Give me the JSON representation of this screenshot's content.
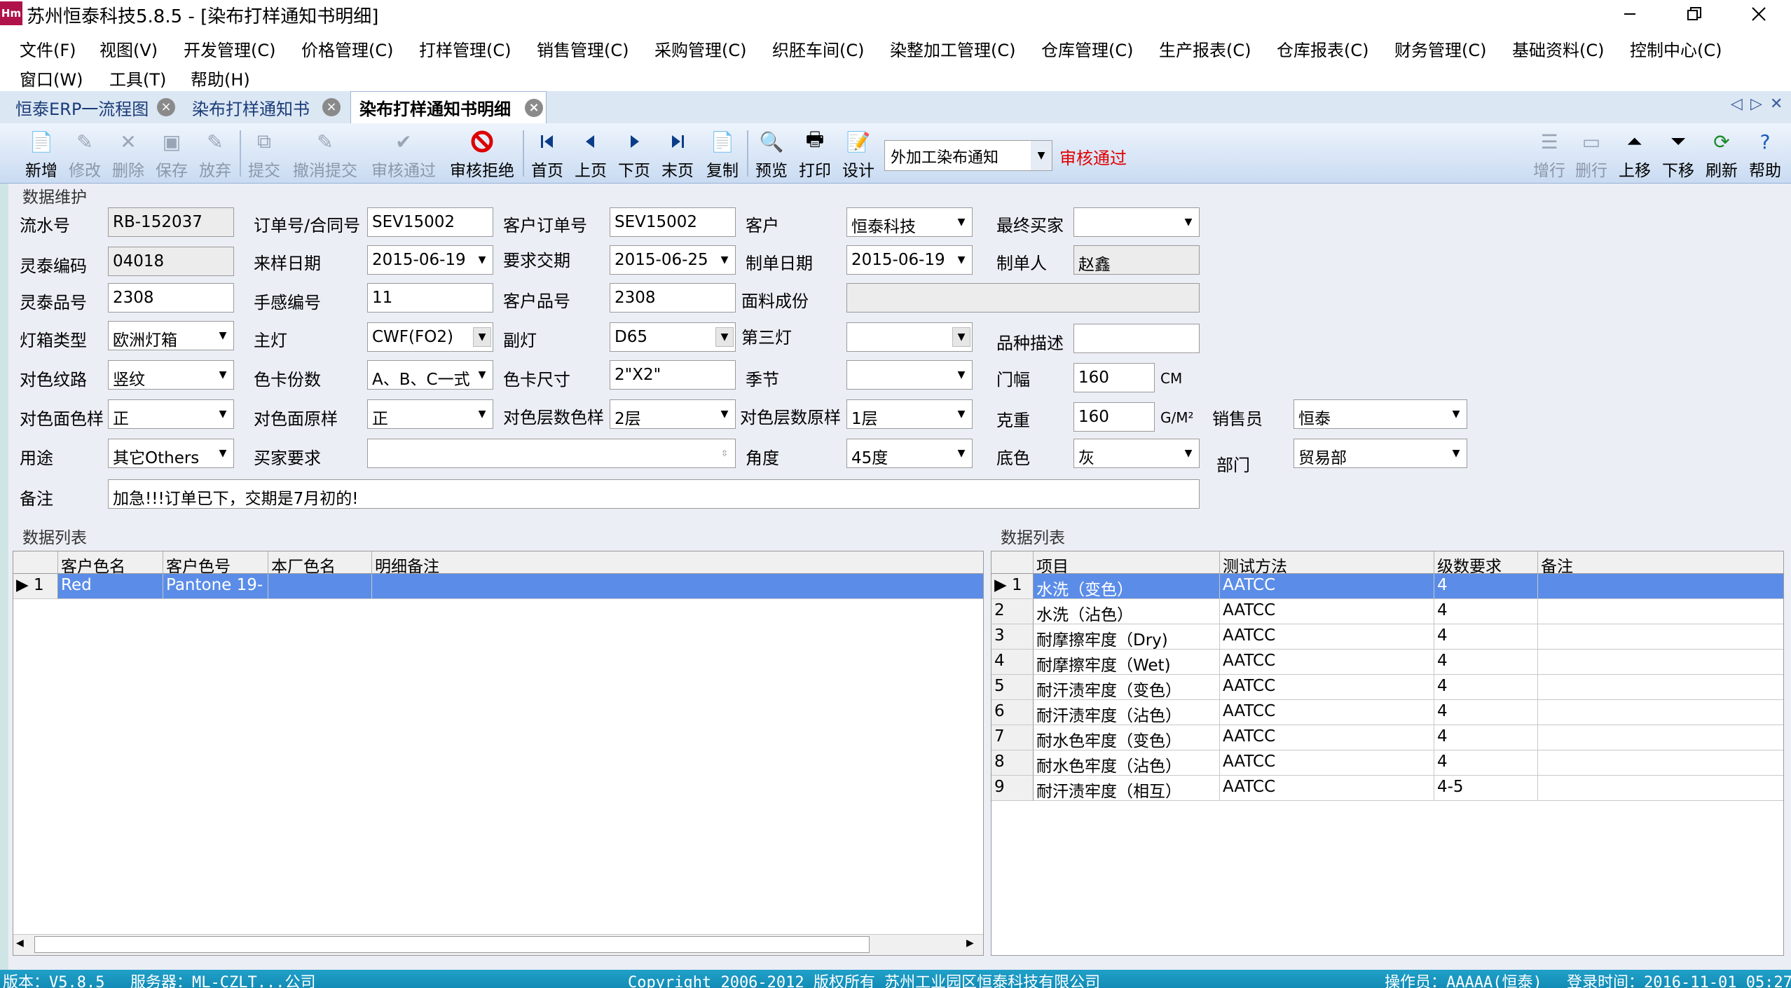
{
  "window": {
    "title": "苏州恒泰科技5.8.5 - [染布打样通知书明细]",
    "icon": "Hm"
  },
  "menu": [
    "文件(F)",
    "视图(V)",
    "开发管理(C)",
    "价格管理(C)",
    "打样管理(C)",
    "销售管理(C)",
    "采购管理(C)",
    "织胚车间(C)",
    "染整加工管理(C)",
    "仓库管理(C)",
    "生产报表(C)",
    "仓库报表(C)",
    "财务管理(C)",
    "基础资料(C)",
    "控制中心(C)",
    "窗口(W)",
    "工具(T)",
    "帮助(H)"
  ],
  "tabs": [
    "恒泰ERP一流程图",
    "染布打样通知书",
    "染布打样通知书明细"
  ],
  "toolbar": {
    "buttons": [
      "新增",
      "修改",
      "删除",
      "保存",
      "放弃",
      "提交",
      "撤消提交",
      "审核通过",
      "审核拒绝",
      "首页",
      "上页",
      "下页",
      "末页",
      "复制",
      "预览",
      "打印",
      "设计"
    ],
    "right_buttons": [
      "增行",
      "删行",
      "上移",
      "下移",
      "刷新",
      "帮助"
    ],
    "doc_type": "外加工染布通知",
    "status": "审核通过"
  },
  "form": {
    "section_title": "数据维护",
    "labels": {
      "serial": "流水号",
      "order": "订单号/合同号",
      "cust_order": "客户订单号",
      "customer": "客户",
      "final_buyer": "最终买家",
      "code": "灵泰编码",
      "sample_date": "来样日期",
      "req_date": "要求交期",
      "make_date": "制单日期",
      "maker": "制单人",
      "product_no": "灵泰品号",
      "hand_no": "手感编号",
      "cust_product": "客户品号",
      "composition": "面料成份",
      "lightbox": "灯箱类型",
      "main_light": "主灯",
      "sub_light": "副灯",
      "third_light": "第三灯",
      "desc": "品种描述",
      "texture": "对色纹路",
      "card_copies": "色卡份数",
      "card_size": "色卡尺寸",
      "season": "季节",
      "width": "门幅",
      "face_sample": "对色面色样",
      "face_orig": "对色面原样",
      "layer_sample": "对色层数色样",
      "layer_orig": "对色层数原样",
      "weight": "克重",
      "sales": "销售员",
      "usage": "用途",
      "buyer_req": "买家要求",
      "angle": "角度",
      "base_color": "底色",
      "dept": "部门",
      "remark": "备注"
    },
    "values": {
      "serial": "RB-152037",
      "order": "SEV15002",
      "cust_order": "SEV15002",
      "customer": "恒泰科技",
      "final_buyer": "",
      "code": "04018",
      "sample_date": "2015-06-19",
      "req_date": "2015-06-25",
      "make_date": "2015-06-19",
      "maker": "赵鑫",
      "product_no": "2308",
      "hand_no": "11",
      "cust_product": "2308",
      "composition": "",
      "lightbox": "欧洲灯箱",
      "main_light": "CWF(FO2)",
      "sub_light": "D65",
      "third_light": "",
      "desc": "",
      "texture": "竖纹",
      "card_copies": "A、B、C一式",
      "card_size": "2\"X2\"",
      "season": "",
      "width": "160",
      "face_sample": "正",
      "face_orig": "正",
      "layer_sample": "2层",
      "layer_orig": "1层",
      "weight": "160",
      "sales": "恒泰",
      "usage": "其它Others",
      "buyer_req": "",
      "angle": "45度",
      "base_color": "灰",
      "dept": "贸易部",
      "remark": "加急!!!订单已下，交期是7月初的!"
    },
    "units": {
      "width": "CM",
      "weight": "G/M²"
    }
  },
  "left_grid": {
    "title": "数据列表",
    "columns": [
      "客户色名",
      "客户色号",
      "本厂色名",
      "明细备注"
    ],
    "rows": [
      {
        "no": "1",
        "c": [
          "Red",
          "Pantone 19-",
          "",
          ""
        ]
      }
    ]
  },
  "right_grid": {
    "title": "数据列表",
    "columns": [
      "项目",
      "测试方法",
      "级数要求",
      "备注"
    ],
    "rows": [
      {
        "no": "1",
        "c": [
          "水洗（变色）",
          "AATCC",
          "4",
          ""
        ]
      },
      {
        "no": "2",
        "c": [
          "水洗（沾色）",
          "AATCC",
          "4",
          ""
        ]
      },
      {
        "no": "3",
        "c": [
          "耐摩擦牢度（Dry)",
          "AATCC",
          "4",
          ""
        ]
      },
      {
        "no": "4",
        "c": [
          "耐摩擦牢度（Wet)",
          "AATCC",
          "4",
          ""
        ]
      },
      {
        "no": "5",
        "c": [
          "耐汗渍牢度（变色）",
          "AATCC",
          "4",
          ""
        ]
      },
      {
        "no": "6",
        "c": [
          "耐汗渍牢度（沾色）",
          "AATCC",
          "4",
          ""
        ]
      },
      {
        "no": "7",
        "c": [
          "耐水色牢度（变色）",
          "AATCC",
          "4",
          ""
        ]
      },
      {
        "no": "8",
        "c": [
          "耐水色牢度（沾色）",
          "AATCC",
          "4",
          ""
        ]
      },
      {
        "no": "9",
        "c": [
          "耐汗渍牢度（相互）",
          "AATCC",
          "4-5",
          ""
        ]
      }
    ]
  },
  "status": {
    "version": "版本：V5.8.5",
    "server": "服务器：ML-CZLT...公司",
    "copyright": "Copyright 2006-2012 版权所有 苏州工业园区恒泰科技有限公司",
    "operator": "操作员：AAAAA(恒泰)",
    "login": "登录时间：2016-11-01 05:27"
  }
}
